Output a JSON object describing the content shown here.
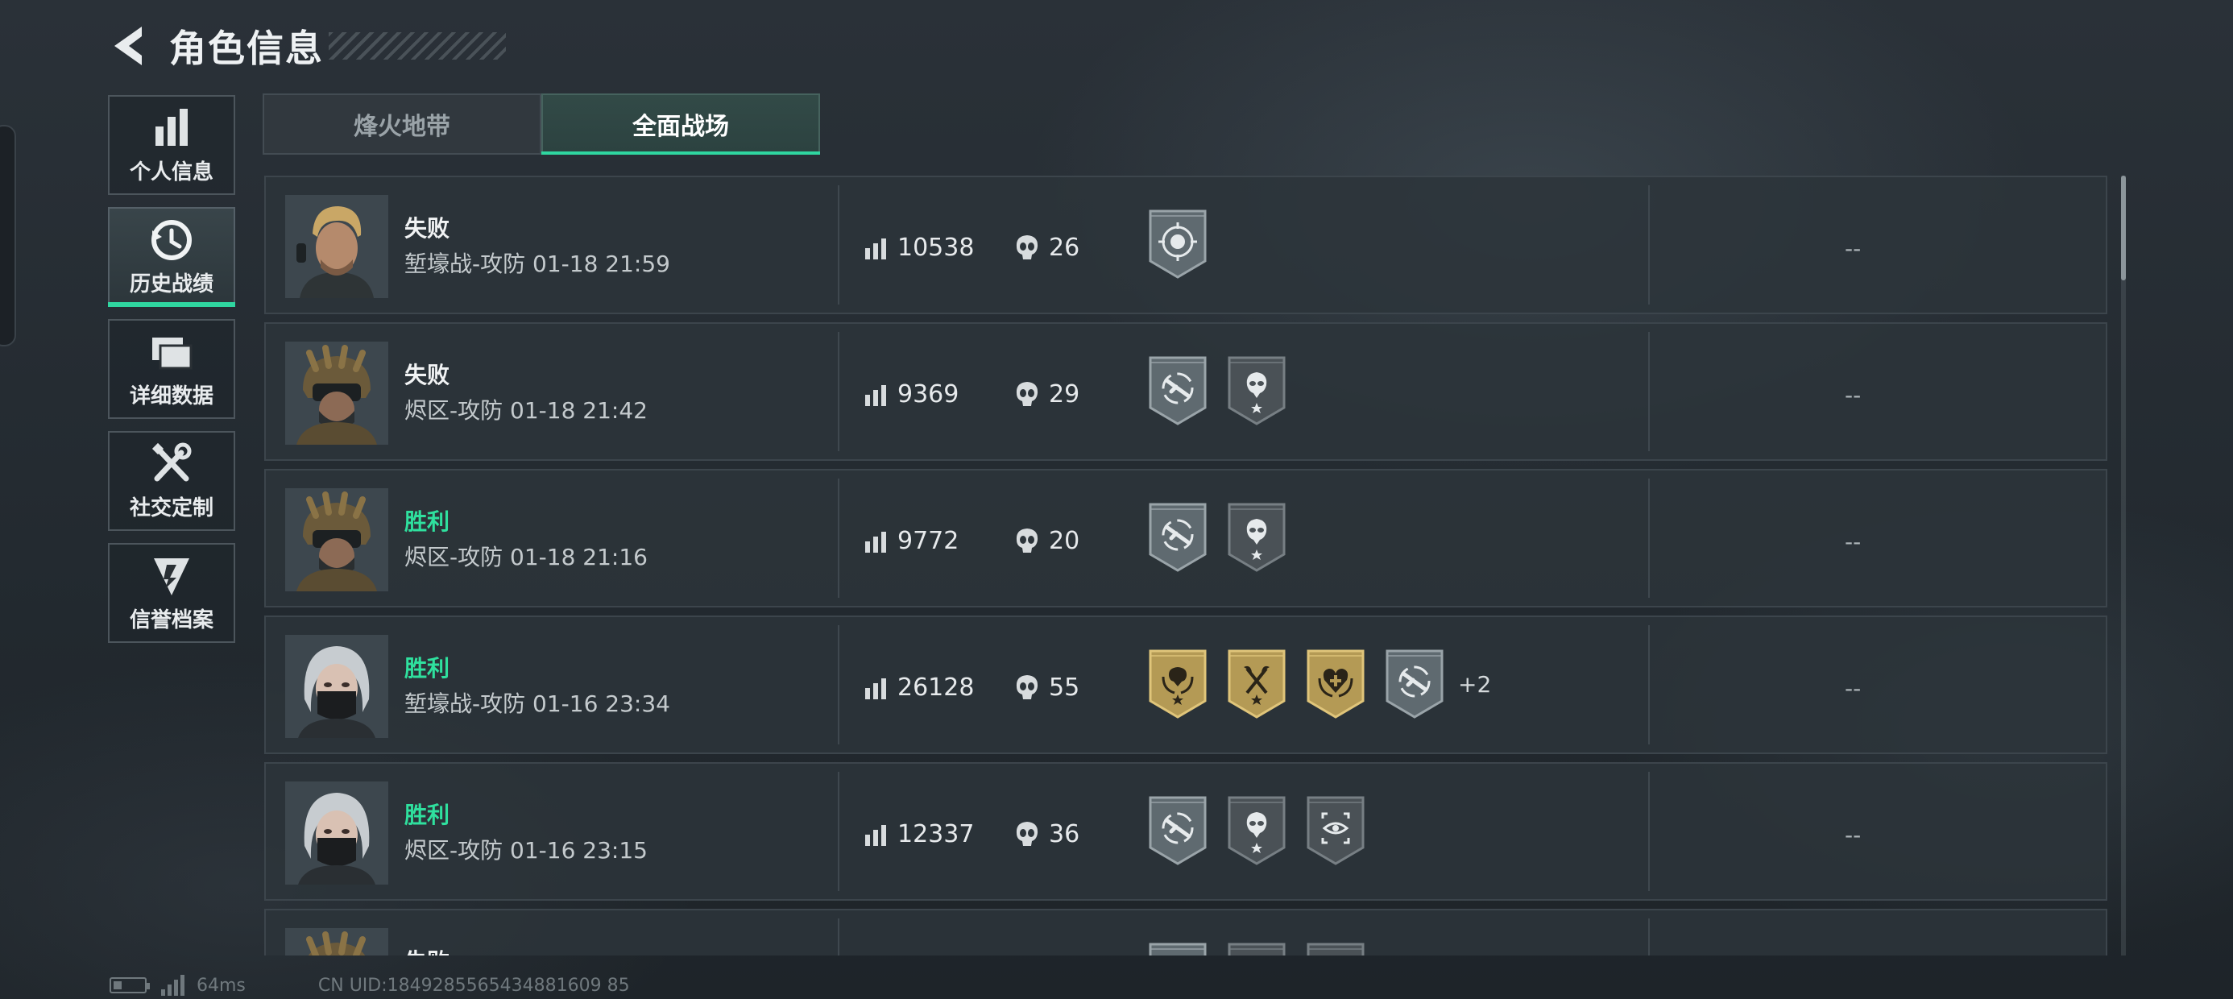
{
  "header": {
    "title": "角色信息"
  },
  "sidebar": {
    "items": [
      {
        "label": "个人信息",
        "icon": "bar-chart-icon",
        "active": false
      },
      {
        "label": "历史战绩",
        "icon": "history-clock-icon",
        "active": true
      },
      {
        "label": "详细数据",
        "icon": "folder-data-icon",
        "active": false
      },
      {
        "label": "社交定制",
        "icon": "wrench-screwdriver-icon",
        "active": false
      },
      {
        "label": "信誉档案",
        "icon": "credibility-shield-icon",
        "active": false
      }
    ]
  },
  "tabs": [
    {
      "label": "烽火地带",
      "active": false
    },
    {
      "label": "全面战场",
      "active": true
    }
  ],
  "matches": [
    {
      "result": "失败",
      "outcome": "loss",
      "mode": "堑壕战-攻防",
      "time": "01-18 21:59",
      "score": "10538",
      "kills": "26",
      "badges": [
        "skull-target-badge"
      ],
      "extra": "",
      "note": "--",
      "avatar": "blond-operator"
    },
    {
      "result": "失败",
      "outcome": "loss",
      "mode": "烬区-攻防",
      "time": "01-18 21:42",
      "score": "9369",
      "kills": "29",
      "badges": [
        "rifle-target-badge",
        "alien-star-badge"
      ],
      "extra": "",
      "note": "--",
      "avatar": "helmet-operator"
    },
    {
      "result": "胜利",
      "outcome": "win",
      "mode": "烬区-攻防",
      "time": "01-18 21:16",
      "score": "9772",
      "kills": "20",
      "badges": [
        "rifle-target-badge",
        "alien-star-badge"
      ],
      "extra": "",
      "note": "--",
      "avatar": "helmet-operator"
    },
    {
      "result": "胜利",
      "outcome": "win",
      "mode": "堑壕战-攻防",
      "time": "01-16 23:34",
      "score": "26128",
      "kills": "55",
      "badges": [
        "gold-skull-wreath-badge",
        "gold-axes-badge",
        "gold-heart-badge",
        "rifle-target-badge"
      ],
      "extra": "+2",
      "note": "--",
      "avatar": "silver-hair-operator"
    },
    {
      "result": "胜利",
      "outcome": "win",
      "mode": "烬区-攻防",
      "time": "01-16 23:15",
      "score": "12337",
      "kills": "36",
      "badges": [
        "rifle-target-badge",
        "alien-star-badge",
        "eye-scan-badge"
      ],
      "extra": "",
      "note": "--",
      "avatar": "silver-hair-operator"
    },
    {
      "result": "失败",
      "outcome": "loss",
      "mode": "",
      "time": "",
      "score": "",
      "kills": "",
      "badges": [
        "rifle-target-badge",
        "alien-star-badge",
        "eye-scan-badge"
      ],
      "extra": "",
      "note": "",
      "avatar": "helmet-operator"
    }
  ],
  "footer": {
    "ping": "64ms",
    "uid": "CN UID:1849285565434881609 85"
  }
}
